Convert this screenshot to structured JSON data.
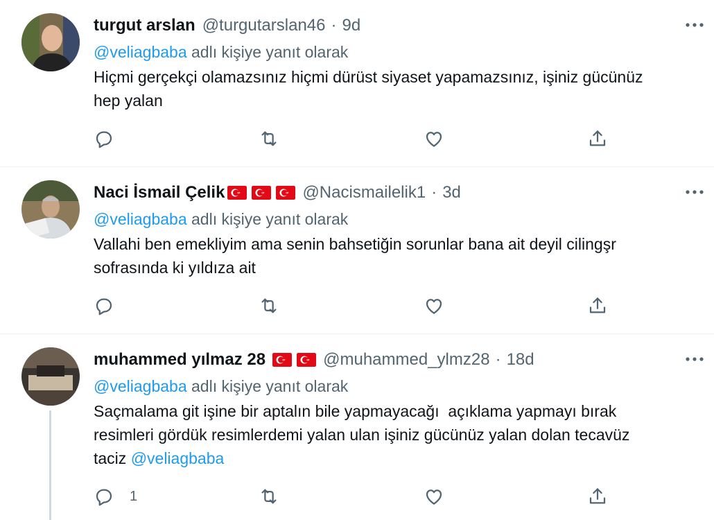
{
  "tweets": [
    {
      "name": "turgut arslan",
      "handle": "@turgutarslan46",
      "time": "9d",
      "reply_prefix": "@veliagbaba",
      "reply_suffix": " adlı kişiye yanıt olarak",
      "text": "Hiçmi gerçekçi olamazsınız hiçmi dürüst siyaset yapamazsınız, işiniz gücünüz\nhep yalan",
      "flags": 0,
      "reply_count": ""
    },
    {
      "name": "Naci İsmail Çelik",
      "handle": "@Nacismailelik1",
      "time": "3d",
      "reply_prefix": "@veliagbaba",
      "reply_suffix": " adlı kişiye yanıt olarak",
      "text": "Vallahi ben emekliyim ama senin bahsetiğin sorunlar bana ait deyil cilingşr\nsofrasında ki yıldıza ait",
      "flags": 3,
      "reply_count": ""
    },
    {
      "name": "muhammed yılmaz 28",
      "handle": "@muhammed_ylmz28",
      "time": "18d",
      "reply_prefix": "@veliagbaba",
      "reply_suffix": " adlı kişiye yanıt olarak",
      "text_part1": "Saçmalama git işine bir aptalın bile yapmayacağı  açıklama yapmayı bırak\nresimleri gördük resimlerdemi yalan ulan işiniz gücünüz yalan dolan tecavüz\ntaciz ",
      "text_mention": "@veliagbaba",
      "flags": 2,
      "reply_count": "1"
    }
  ],
  "separator": "·",
  "colors": {
    "accent": "#1d9bf0",
    "secondary_text": "#536471",
    "flag_red": "#e30a17",
    "thread_line": "#cfd9de"
  },
  "icons": [
    "reply-icon",
    "retweet-icon",
    "like-icon",
    "share-icon",
    "more-icon",
    "turkish-flag-icon"
  ]
}
